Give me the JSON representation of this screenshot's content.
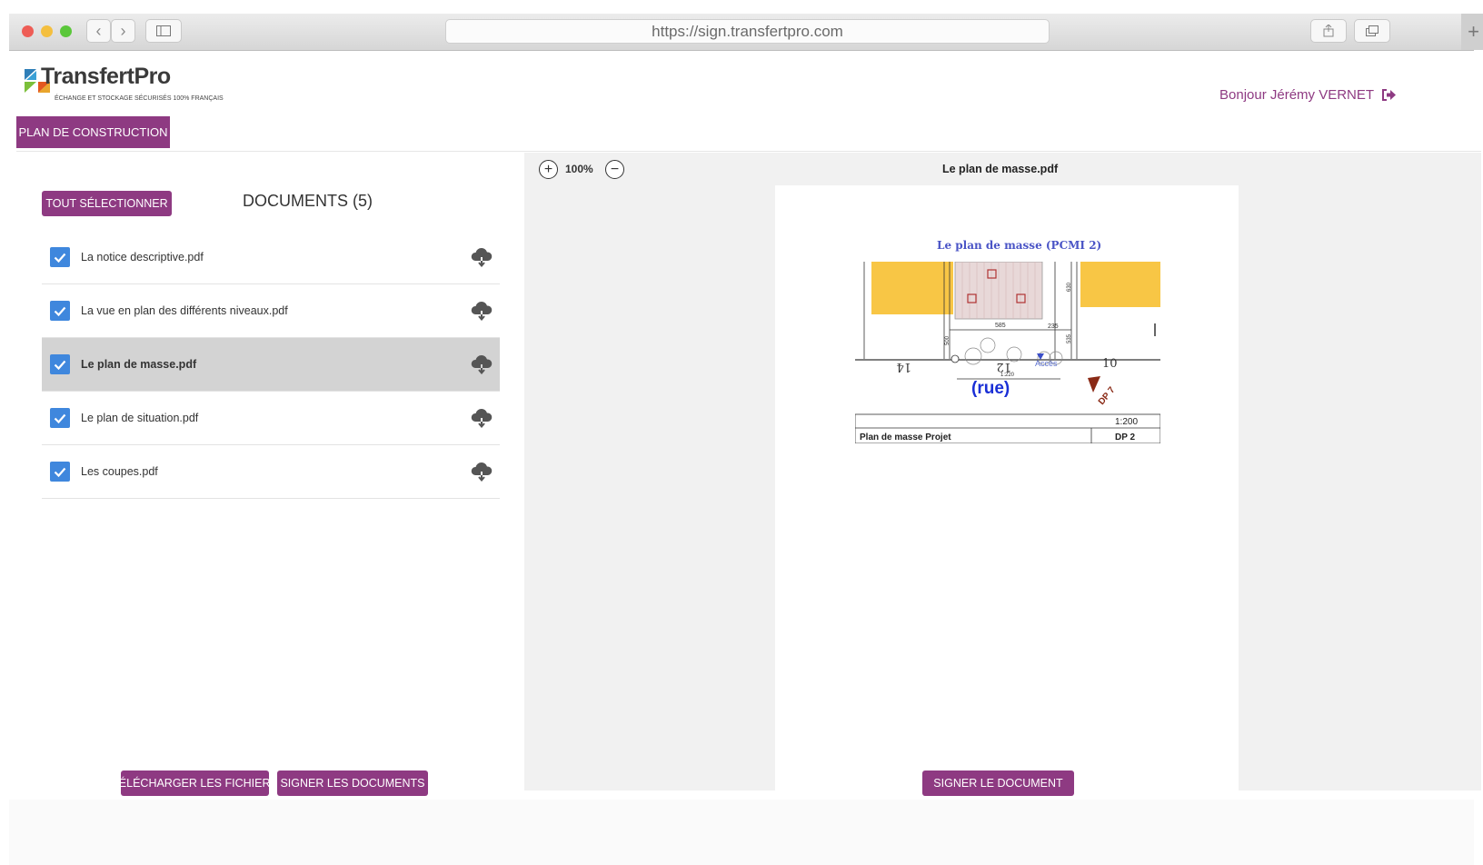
{
  "browser": {
    "url": "https://sign.transfertpro.com",
    "colors": {
      "close": "#ee5d56",
      "minimize": "#f4bf3f",
      "zoom": "#5ac73a"
    }
  },
  "header": {
    "logo_name": "TransfertPro",
    "logo_tagline": "ÉCHANGE ET STOCKAGE SÉCURISÉS 100% FRANÇAIS",
    "project_tab": "PLAN DE CONSTRUCTION",
    "greeting": "Bonjour Jérémy VERNET"
  },
  "documents": {
    "select_all": "TOUT SÉLECTIONNER",
    "title": "DOCUMENTS (5)",
    "items": [
      {
        "name": "La notice descriptive.pdf"
      },
      {
        "name": "La vue en plan des différents niveaux.pdf"
      },
      {
        "name": "Le plan de masse.pdf"
      },
      {
        "name": "Le plan de situation.pdf"
      },
      {
        "name": "Les coupes.pdf"
      }
    ]
  },
  "viewer": {
    "zoom": "100%",
    "file_title": "Le plan de masse.pdf",
    "plan": {
      "title": "Le plan de masse (PCMI 2)",
      "street": "(rue)",
      "access": "Accès",
      "scale": "1:200",
      "scale_small": "1:220",
      "caption": "Plan de masse Projet",
      "code": "DP 2",
      "photo_marker": "DP 7",
      "lot_left": "14",
      "lot_center": "12",
      "lot_right": "10",
      "dim_1": "585",
      "dim_2": "235",
      "dim_3": "500",
      "dim_4": "535",
      "dim_5": "630"
    }
  },
  "actions": {
    "download": "TÉLÉCHARGER LES FICHIERS",
    "sign_all": "SIGNER LES DOCUMENTS",
    "sign_one": "SIGNER LE DOCUMENT"
  },
  "theme": {
    "accent": "#8e3a82",
    "checkbox": "#3f87dd",
    "plan_yellow": "#f8c645",
    "plan_red": "#b03232"
  }
}
